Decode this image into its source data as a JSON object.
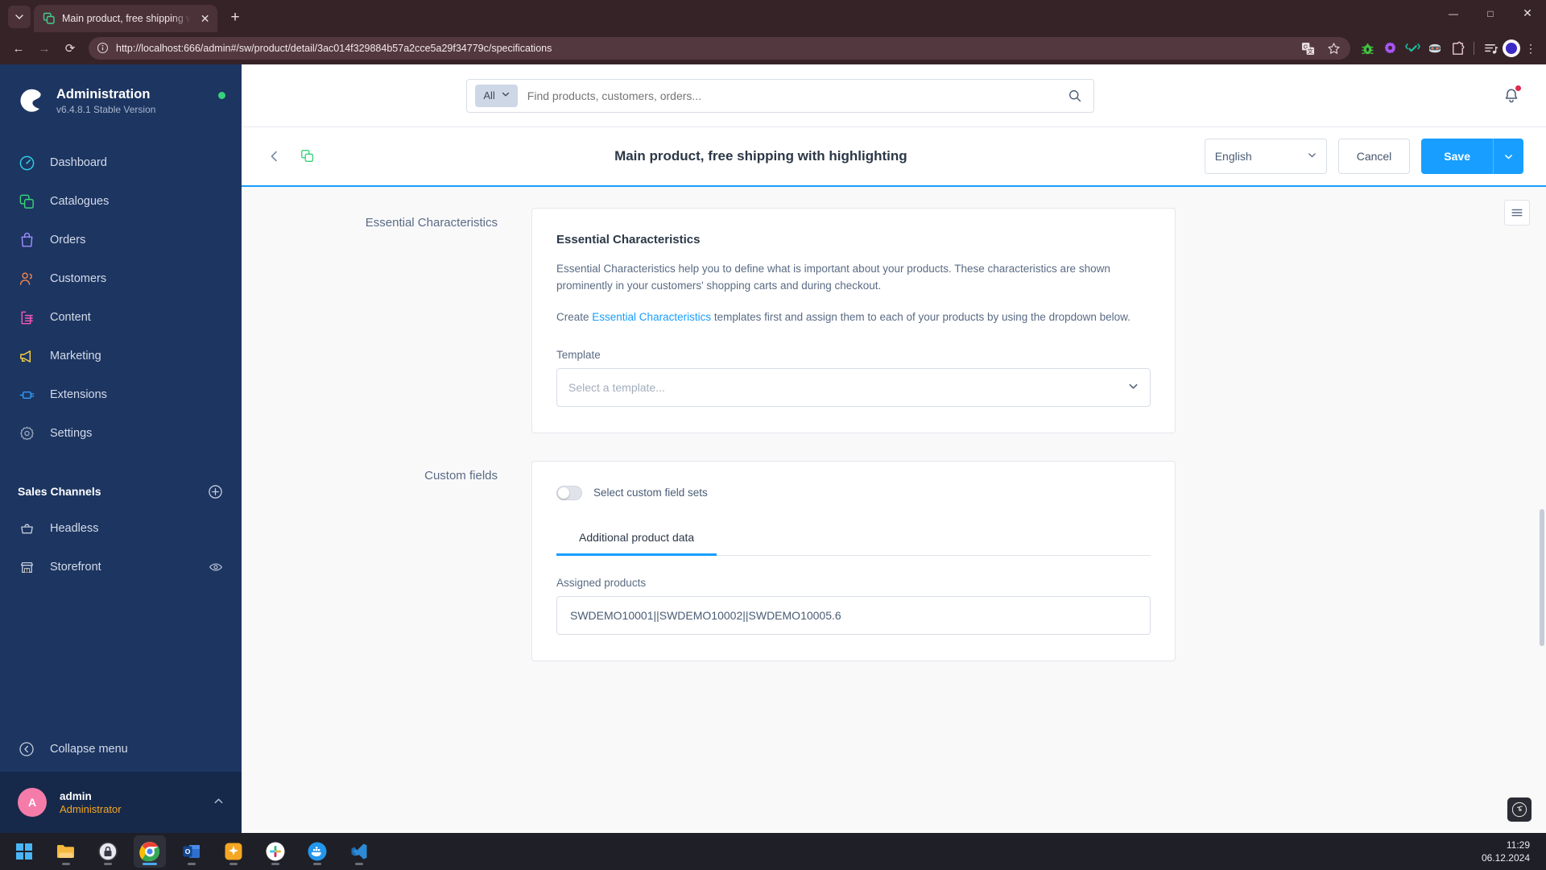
{
  "browser": {
    "tab": {
      "title": "Main product, free shipping wit",
      "favicon": "shopware-product-icon",
      "close_label": "✕"
    },
    "tab_list_icon": "chevron-down-icon",
    "new_tab_label": "+",
    "window_controls": {
      "minimize": "—",
      "maximize": "□",
      "close": "✕"
    },
    "nav": {
      "back": "←",
      "forward": "→",
      "reload": "⟳"
    },
    "omnibox": {
      "info_icon": "site-info-icon",
      "url": "http://localhost:666/admin#/sw/product/detail/3ac014f329884b57a2cce5a29f34779c/specifications",
      "translate_icon": "translate-icon",
      "bookmark_icon": "star-icon"
    },
    "extensions": [
      {
        "name": "bug-extension-icon",
        "color": "#3ec23e"
      },
      {
        "name": "gear-extension-icon",
        "color": "#a855f7"
      },
      {
        "name": "checkmark-extension-icon",
        "color": "#17c5a0"
      },
      {
        "name": "robot-extension-icon",
        "color": "#3f7a8c"
      },
      {
        "name": "puzzle-extension-icon",
        "color": "#e8c9cd"
      }
    ],
    "side_panel_icon": "reading-list-icon",
    "profile_icon": "profile-avatar",
    "menu_icon": "kebab-menu-icon"
  },
  "sidebar": {
    "brand": {
      "title": "Administration",
      "version": "v6.4.8.1 Stable Version",
      "logo": "shopware-logo",
      "status": "online-dot"
    },
    "items": [
      {
        "label": "Dashboard",
        "icon": "dashboard-icon",
        "color": "#2fd2e8"
      },
      {
        "label": "Catalogues",
        "icon": "catalogues-icon",
        "color": "#37d279"
      },
      {
        "label": "Orders",
        "icon": "orders-icon",
        "color": "#a18cff"
      },
      {
        "label": "Customers",
        "icon": "customers-icon",
        "color": "#f2844b"
      },
      {
        "label": "Content",
        "icon": "content-icon",
        "color": "#f558b5"
      },
      {
        "label": "Marketing",
        "icon": "marketing-icon",
        "color": "#f7d046"
      },
      {
        "label": "Extensions",
        "icon": "extensions-icon",
        "color": "#2f9bf5"
      },
      {
        "label": "Settings",
        "icon": "settings-icon",
        "color": "#9aa7bb"
      }
    ],
    "sales_channels": {
      "title": "Sales Channels",
      "add_icon": "plus-circle-icon",
      "items": [
        {
          "label": "Headless",
          "icon": "basket-icon",
          "trailing": ""
        },
        {
          "label": "Storefront",
          "icon": "storefront-icon",
          "trailing": "eye-icon"
        }
      ]
    },
    "collapse": {
      "label": "Collapse menu",
      "icon": "collapse-icon"
    },
    "user": {
      "initial": "A",
      "name": "admin",
      "role": "Administrator",
      "caret": "chevron-up-icon"
    }
  },
  "topbar": {
    "search": {
      "scope": "All",
      "scope_caret": "chevron-down-icon",
      "placeholder": "Find products, customers, orders...",
      "value": "",
      "submit_icon": "search-icon"
    },
    "notifications_icon": "bell-icon"
  },
  "pagehead": {
    "back_icon": "chevron-left-icon",
    "product_icon": "product-duplicate-icon",
    "title": "Main product, free shipping with highlighting",
    "language": "English",
    "language_caret": "chevron-down-icon",
    "cancel_label": "Cancel",
    "save_label": "Save",
    "save_caret": "chevron-down-icon",
    "accent_color": "#189eff"
  },
  "content": {
    "essential": {
      "section_label": "Essential Characteristics",
      "card_title": "Essential Characteristics",
      "paragraph_1": "Essential Characteristics help you to define what is important about your products. These characteristics are shown prominently in your customers' shopping carts and during checkout.",
      "paragraph_2_before": "Create ",
      "paragraph_2_link": "Essential Characteristics",
      "paragraph_2_after": " templates first and assign them to each of your products by using the dropdown below.",
      "template_label": "Template",
      "template_placeholder": "Select a template...",
      "template_caret": "chevron-down-icon"
    },
    "custom_fields": {
      "section_label": "Custom fields",
      "toggle_label": "Select custom field sets",
      "toggle_state": "off",
      "tabs": [
        {
          "label": "Additional product data",
          "active": true
        }
      ],
      "assigned_label": "Assigned products",
      "assigned_value": "SWDEMO10001||SWDEMO10002||SWDEMO10005.6"
    },
    "side_panel_icon": "sidebar-toggle-icon",
    "symfony_badge": "symfony-profiler-icon"
  },
  "taskbar": {
    "apps": [
      {
        "name": "windows-start-icon"
      },
      {
        "name": "file-explorer-icon"
      },
      {
        "name": "keepass-icon"
      },
      {
        "name": "chrome-icon",
        "active": true
      },
      {
        "name": "outlook-icon"
      },
      {
        "name": "star-app-icon"
      },
      {
        "name": "slack-icon"
      },
      {
        "name": "docker-icon"
      },
      {
        "name": "vscode-icon"
      }
    ],
    "clock": {
      "time": "11:29",
      "date": "06.12.2024"
    }
  }
}
